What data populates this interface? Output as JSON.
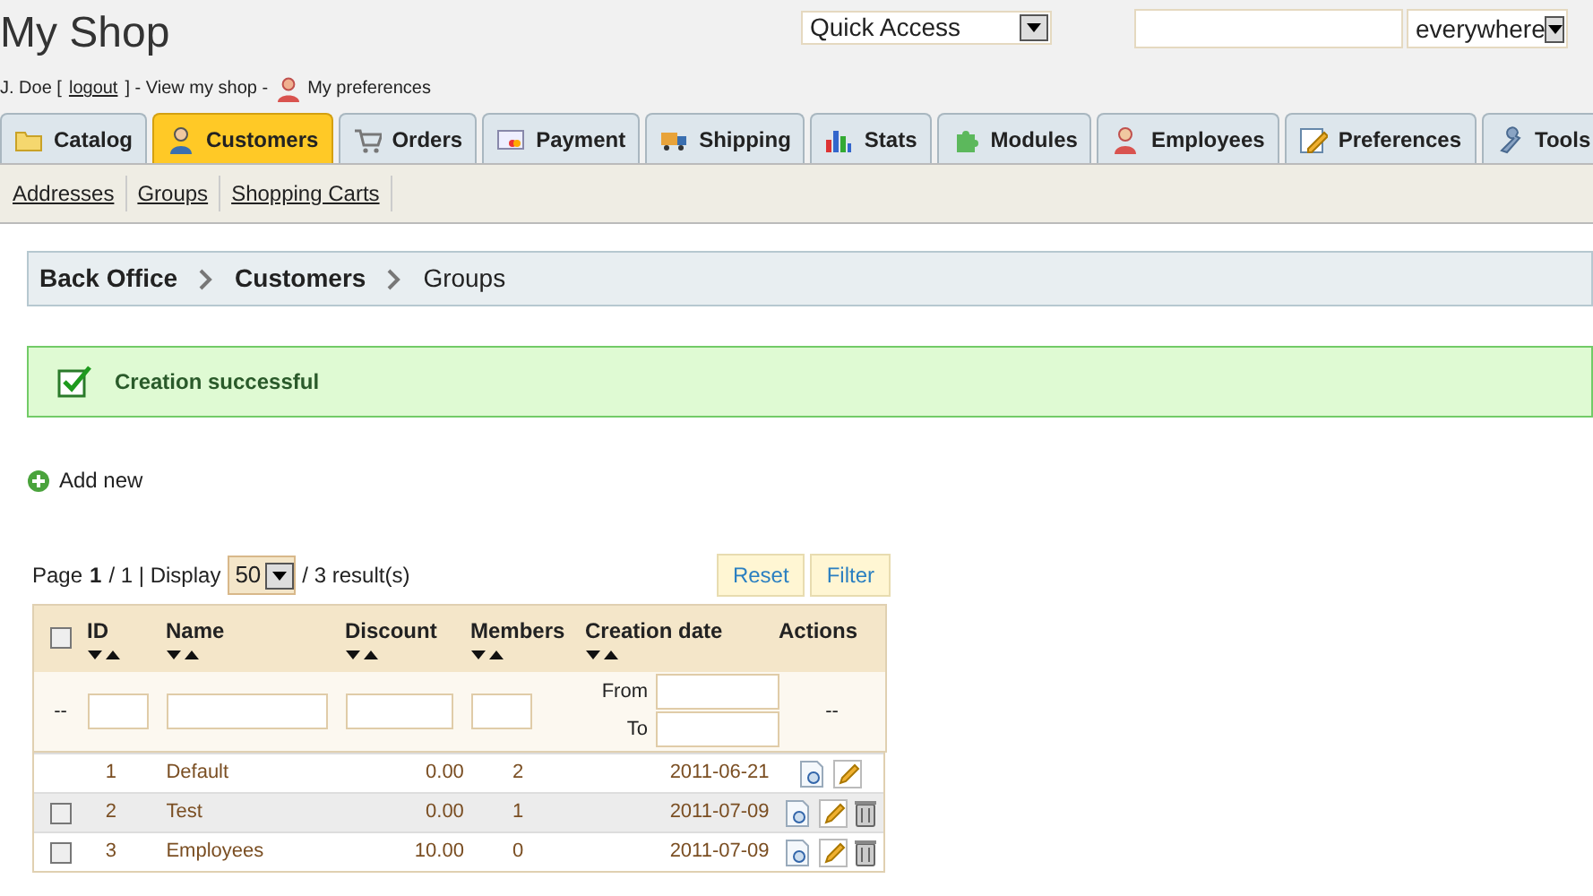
{
  "header": {
    "title": "My Shop",
    "quick_access": "Quick Access",
    "search_scope": "everywhere",
    "user_line": {
      "name": "J. Doe [",
      "logout": "logout",
      "middle": "] - View my shop -",
      "preferences": "My preferences"
    }
  },
  "tabs": [
    {
      "label": "Catalog",
      "selected": false
    },
    {
      "label": "Customers",
      "selected": true
    },
    {
      "label": "Orders",
      "selected": false
    },
    {
      "label": "Payment",
      "selected": false
    },
    {
      "label": "Shipping",
      "selected": false
    },
    {
      "label": "Stats",
      "selected": false
    },
    {
      "label": "Modules",
      "selected": false
    },
    {
      "label": "Employees",
      "selected": false
    },
    {
      "label": "Preferences",
      "selected": false
    },
    {
      "label": "Tools",
      "selected": false
    }
  ],
  "subtabs": [
    "Addresses",
    "Groups",
    "Shopping Carts"
  ],
  "breadcrumb": [
    "Back Office",
    "Customers",
    "Groups"
  ],
  "message": "Creation successful",
  "add_new": "Add new",
  "pagination": {
    "page_label": "Page",
    "page": "1",
    "total": "/ 1 | Display",
    "per_page": "50",
    "results": "/ 3 result(s)"
  },
  "buttons": [
    "Reset",
    "Filter"
  ],
  "table": {
    "select_all_checked": false,
    "columns": [
      "ID",
      "Name",
      "Discount",
      "Members",
      "Creation date",
      "Actions"
    ],
    "filter_row": {
      "left": "--",
      "from": "From",
      "to": "To",
      "right": "--"
    },
    "rows": [
      {
        "id": "1",
        "name": "Default",
        "discount": "0.00",
        "members": "2",
        "date": "2011-06-21",
        "deletable": false
      },
      {
        "id": "2",
        "name": "Test",
        "discount": "0.00",
        "members": "1",
        "date": "2011-07-09",
        "deletable": true,
        "checked": false
      },
      {
        "id": "3",
        "name": "Employees",
        "discount": "10.00",
        "members": "0",
        "date": "2011-07-09",
        "deletable": true,
        "checked": false
      }
    ]
  }
}
